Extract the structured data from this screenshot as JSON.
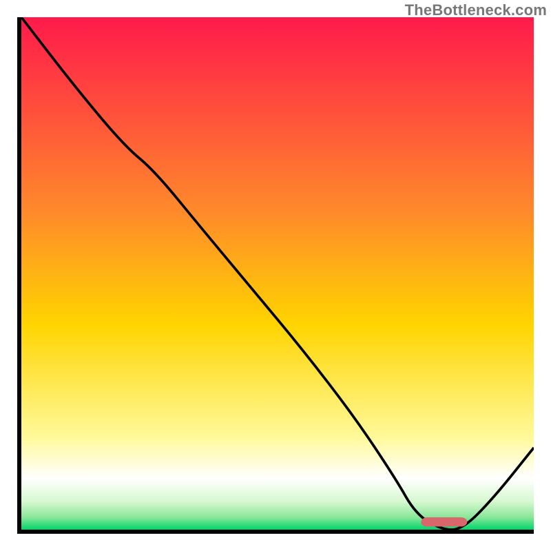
{
  "watermark": "TheBottleneck.com",
  "chart_data": {
    "type": "line",
    "title": "",
    "xlabel": "",
    "ylabel": "",
    "xlim": [
      0,
      100
    ],
    "ylim": [
      0,
      100
    ],
    "background_gradient": [
      {
        "stop": 0.0,
        "color": "#ff1a4b"
      },
      {
        "stop": 0.38,
        "color": "#ff8a2b"
      },
      {
        "stop": 0.6,
        "color": "#ffd400"
      },
      {
        "stop": 0.82,
        "color": "#fff99a"
      },
      {
        "stop": 0.9,
        "color": "#ffffff"
      },
      {
        "stop": 0.945,
        "color": "#d6f8cf"
      },
      {
        "stop": 0.975,
        "color": "#8de79b"
      },
      {
        "stop": 1.0,
        "color": "#00d56a"
      }
    ],
    "series": [
      {
        "name": "bottleneck-curve",
        "x": [
          0,
          10,
          20,
          26,
          35,
          45,
          55,
          65,
          73,
          77,
          82,
          86,
          92,
          100
        ],
        "y": [
          100,
          87,
          75,
          70,
          59,
          47,
          35,
          22,
          10,
          3,
          0,
          0,
          6,
          16
        ]
      }
    ],
    "marker": {
      "name": "optimal-marker",
      "x_start": 78,
      "x_end": 87,
      "y": 1.5,
      "color": "#d9666b"
    }
  }
}
